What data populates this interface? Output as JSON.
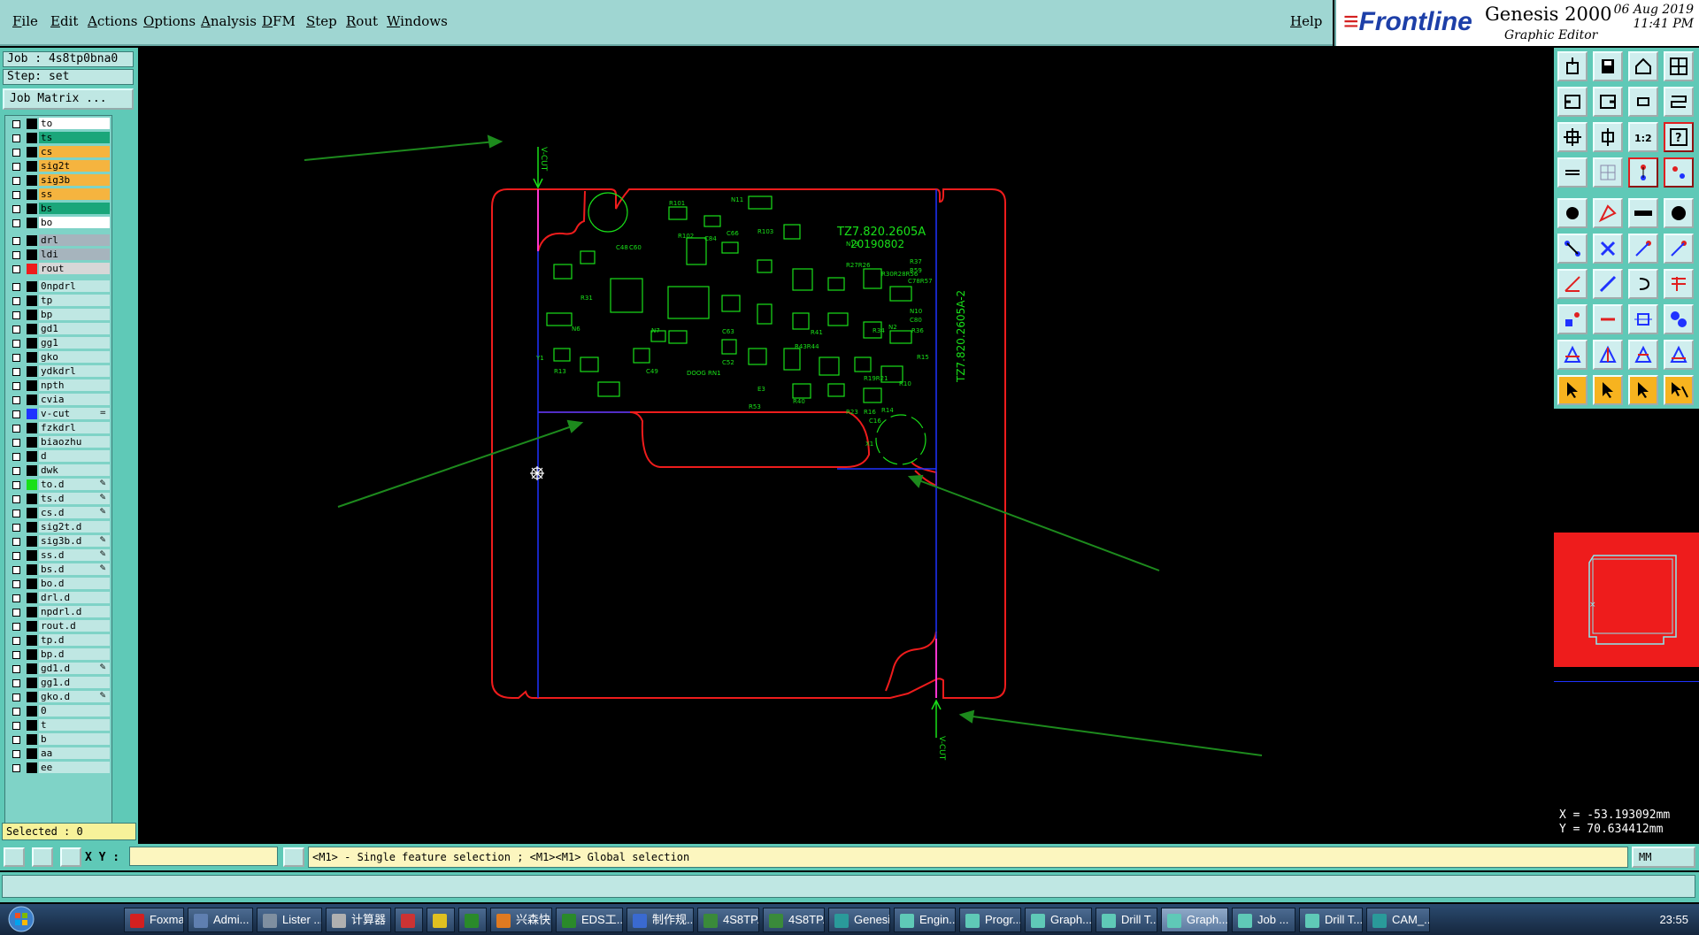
{
  "menu": {
    "items": [
      "File",
      "Edit",
      "Actions",
      "Options",
      "Analysis",
      "DFM",
      "Step",
      "Rout",
      "Windows"
    ],
    "help": "Help"
  },
  "brand": {
    "logo": "Frontline",
    "product": "Genesis 2000",
    "subtitle": "Graphic Editor",
    "date": "06 Aug 2019",
    "time": "11:41 PM"
  },
  "job": "Job : 4s8tp0bna0",
  "step": "Step: set",
  "job_matrix_button": "Job Matrix ...",
  "layers": [
    {
      "name": "to",
      "bg": "#ffffff",
      "swatch": ""
    },
    {
      "name": "ts",
      "bg": "#1aa67a",
      "swatch": ""
    },
    {
      "name": "cs",
      "bg": "#f5b43f",
      "swatch": ""
    },
    {
      "name": "sig2t",
      "bg": "#f5b43f",
      "swatch": ""
    },
    {
      "name": "sig3b",
      "bg": "#f5b43f",
      "swatch": ""
    },
    {
      "name": "ss",
      "bg": "#f5b43f",
      "swatch": ""
    },
    {
      "name": "bs",
      "bg": "#1aa67a",
      "swatch": ""
    },
    {
      "name": "bo",
      "bg": "#ffffff",
      "swatch": ""
    },
    {
      "name": "drl",
      "bg": "#a6b4bd",
      "swatch": "",
      "gap": true
    },
    {
      "name": "ldi",
      "bg": "#a6b4bd",
      "swatch": ""
    },
    {
      "name": "rout",
      "bg": "#d7d7d7",
      "swatch": "#ee1c1c"
    },
    {
      "name": "0npdrl",
      "bg": "#bfe7e3",
      "swatch": "",
      "gap": true
    },
    {
      "name": "tp",
      "bg": "#bfe7e3",
      "swatch": ""
    },
    {
      "name": "bp",
      "bg": "#bfe7e3",
      "swatch": ""
    },
    {
      "name": "gd1",
      "bg": "#bfe7e3",
      "swatch": ""
    },
    {
      "name": "gg1",
      "bg": "#bfe7e3",
      "swatch": ""
    },
    {
      "name": "gko",
      "bg": "#bfe7e3",
      "swatch": ""
    },
    {
      "name": "ydkdrl",
      "bg": "#bfe7e3",
      "swatch": ""
    },
    {
      "name": "npth",
      "bg": "#bfe7e3",
      "swatch": ""
    },
    {
      "name": "cvia",
      "bg": "#bfe7e3",
      "swatch": ""
    },
    {
      "name": "v-cut",
      "bg": "#bfe7e3",
      "swatch": "#1f33ff",
      "mark": "="
    },
    {
      "name": "fzkdrl",
      "bg": "#bfe7e3",
      "swatch": ""
    },
    {
      "name": "biaozhu",
      "bg": "#bfe7e3",
      "swatch": ""
    },
    {
      "name": "d",
      "bg": "#bfe7e3",
      "swatch": ""
    },
    {
      "name": "dwk",
      "bg": "#bfe7e3",
      "swatch": ""
    },
    {
      "name": "to.d",
      "bg": "#bfe7e3",
      "swatch": "#19e019",
      "mark": "✎"
    },
    {
      "name": "ts.d",
      "bg": "#bfe7e3",
      "swatch": "",
      "mark": "✎"
    },
    {
      "name": "cs.d",
      "bg": "#bfe7e3",
      "swatch": "",
      "mark": "✎"
    },
    {
      "name": "sig2t.d",
      "bg": "#bfe7e3",
      "swatch": ""
    },
    {
      "name": "sig3b.d",
      "bg": "#bfe7e3",
      "swatch": "",
      "mark": "✎"
    },
    {
      "name": "ss.d",
      "bg": "#bfe7e3",
      "swatch": "",
      "mark": "✎"
    },
    {
      "name": "bs.d",
      "bg": "#bfe7e3",
      "swatch": "",
      "mark": "✎"
    },
    {
      "name": "bo.d",
      "bg": "#bfe7e3",
      "swatch": ""
    },
    {
      "name": "drl.d",
      "bg": "#bfe7e3",
      "swatch": ""
    },
    {
      "name": "npdrl.d",
      "bg": "#bfe7e3",
      "swatch": ""
    },
    {
      "name": "rout.d",
      "bg": "#bfe7e3",
      "swatch": ""
    },
    {
      "name": "tp.d",
      "bg": "#bfe7e3",
      "swatch": ""
    },
    {
      "name": "bp.d",
      "bg": "#bfe7e3",
      "swatch": ""
    },
    {
      "name": "gd1.d",
      "bg": "#bfe7e3",
      "swatch": "",
      "mark": "✎"
    },
    {
      "name": "gg1.d",
      "bg": "#bfe7e3",
      "swatch": ""
    },
    {
      "name": "gko.d",
      "bg": "#bfe7e3",
      "swatch": "",
      "mark": "✎"
    },
    {
      "name": "0",
      "bg": "#bfe7e3",
      "swatch": ""
    },
    {
      "name": "t",
      "bg": "#bfe7e3",
      "swatch": ""
    },
    {
      "name": "b",
      "bg": "#bfe7e3",
      "swatch": ""
    },
    {
      "name": "aa",
      "bg": "#bfe7e3",
      "swatch": ""
    },
    {
      "name": "ee",
      "bg": "#bfe7e3",
      "swatch": ""
    }
  ],
  "selected": "Selected : 0",
  "canvas": {
    "vcut_label": "V-CUT",
    "board_text_1": "TZ7.820.2605A",
    "board_text_2": "20190802",
    "board_text_side": "TZ7.820.2605A-2",
    "colors": {
      "outline": "#ee1c1c",
      "vcut": "#1f33ff",
      "silk": "#19e019",
      "arrow": "#1d8a1d"
    }
  },
  "coords": {
    "x": "X = -53.193092mm",
    "y": "Y = 70.634412mm"
  },
  "statusbar": {
    "xy_label": "X Y :",
    "xy_value": "",
    "hint": "<M1> - Single feature selection ; <M1><M1> Global selection",
    "units": "MM"
  },
  "taskbar": {
    "items": [
      "Foxmail",
      "Admi...",
      "Lister ...",
      "计算器",
      "",
      "",
      "",
      "兴森快...",
      "EDS工...",
      "制作规...",
      "4S8TP...",
      "4S8TP...",
      "Genesis",
      "Engin...",
      "Progr...",
      "Graph...",
      "Drill T...",
      "Graph...",
      "Job ...",
      "Drill T...",
      "CAM_..."
    ],
    "clock": "23:55"
  }
}
